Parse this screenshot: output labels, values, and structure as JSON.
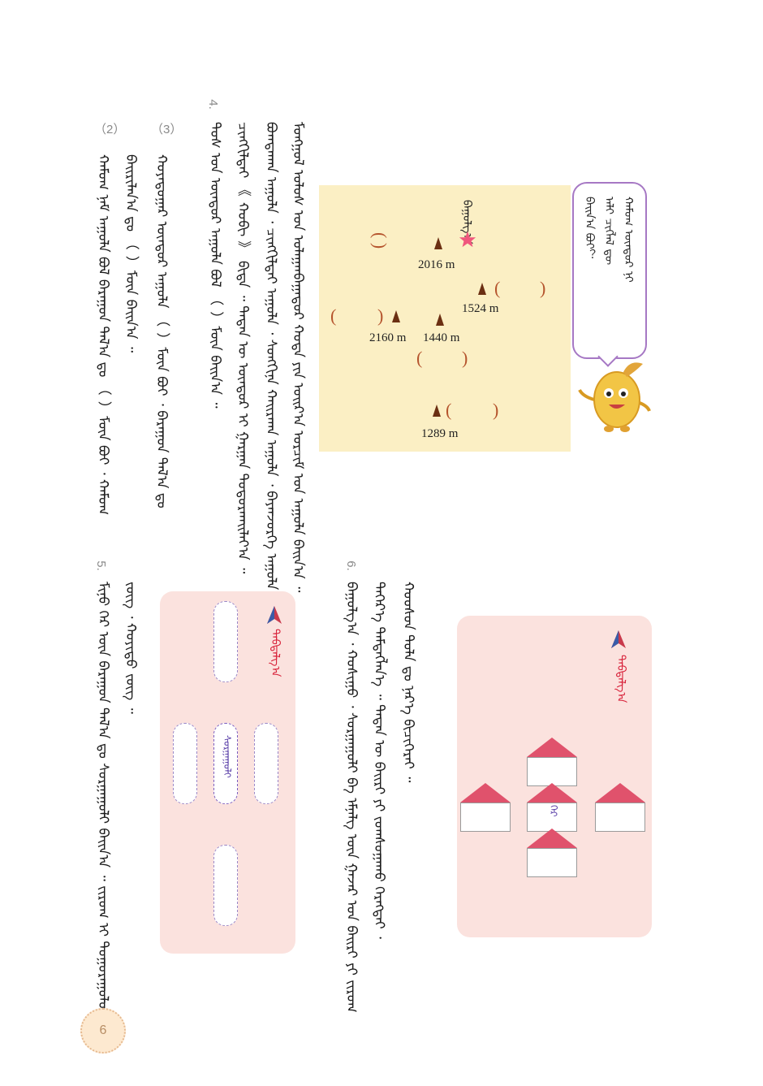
{
  "page_number": "6",
  "q4": {
    "number": "4.",
    "lines": [
      "ᠮᠣᠩᠭᠣᠯ ᠤᠯᠤᠰ ᠤᠨ ᠤᠯᠠᠭᠠᠨᠪᠠᠭᠠᠲᠤᠷ ᠬᠣᠲᠠ ᠶᠢᠨ ᠣᠢᠷ᠎ᠠ ᠣᠷᠴᠢᠮ ᠤᠨ ᠠᠭᠤᠯᠠ ᠪᠠᠢᠨ᠎ᠠ ᠃",
      "ᠪᠣᠭᠳᠠᠬᠠᠨ ᠠᠭᠤᠯᠠ ᠂ ᠴᠢᠩᠭᠢᠯᠲᠡᠢ ᠠᠭᠤᠯᠠ ᠂ ᠰᠣᠩᠭᠢᠨᠠ ᠬᠠᠢᠷᠬᠠᠨ ᠠᠭᠤᠯᠠ ᠂ ᠪᠠᠶᠠᠨᠵᠦᠷᠬᠡ ᠠᠭᠤᠯᠠ ᠂",
      "ᠴᠢᠩᠭᠢᠯᠲᠡᠢ 《 ᠬᠤᠪᠢ 》 ᠪᠢᠳᠡ ᠃ ᠲᠡᠳᠡᠨ ᠦ ᠥᠨᠳᠥᠷ ᠢ ᠭᠠᠷᠭᠠᠨ ᠲᠣᠳᠣᠷᠬᠠᠢᠯᠠᠶ᠎ᠠ ᠃",
      "ᠲᠤᠰ ᠤᠨ ᠥᠨᠳᠥᠷ ᠠᠭᠤᠯᠠ ᠪᠣᠯ （ ）ᠮᠥᠨ ᠪᠠᠢᠨ᠎ᠠ ᠃"
    ],
    "sub3_label": "（3）",
    "sub3_lines": [
      "ᠬᠣᠶᠠᠳᠤᠭᠠᠷ ᠥᠨᠳᠥᠷ ᠠᠭᠤᠯᠠ （ ）ᠮᠥᠨ ᠪᠣᠢ ᠂ ᠪᠠᠷᠠᠭᠤᠨ ᠲᠠᠯ᠎ᠠ ᠳᠤ",
      "ᠪᠠᠢᠷᠢᠯᠠᠨ᠎ᠠ ᠳᠤ （ ）ᠮᠥᠨ ᠪᠠᠢᠨ᠎ᠠ ᠃"
    ],
    "sub2_label": "（2）",
    "sub2_lines": [
      "ᠬᠠᠮᠤᠭ ᠨᠠᠮ ᠠᠭᠤᠯᠠ ᠪᠣᠯ ᠪᠠᠷᠠᠭᠤᠨ ᠲᠠᠯ᠎ᠠ ᠳᠤ （ ）ᠮᠥᠨ ᠪᠣᠢ ᠂ ᠬᠠᠮᠤᠭ"
    ]
  },
  "map": {
    "star_label": "ᠪᠠᠭᠤᠯᠭ᠎ᠠ",
    "elevations": [
      "2016 m",
      "1524 m",
      "2160 m",
      "1440 m",
      "1289 m"
    ],
    "paren": "(          )"
  },
  "bubble_lines": [
    "ᠬᠠᠮᠤᠭ ᠥᠨᠳᠥᠷ ᠨᠢ",
    "ᠠᠯᠢ ᠴᠢᠭᠯᠡᠯ ᠳᠦ",
    "ᠪᠠᠢᠨ᠎ᠠ ᠪᠣᠢ？"
  ],
  "q6": {
    "number": "6.",
    "lines": [
      "ᠪᠠᠭᠤᠯᠭ᠎ᠠ ᠂ ᠬᠣᠰᠢᠭᠤ ᠂ ᠰᠤᠷᠭᠠᠭᠤᠯᠢ ᠪᠠ ᠡᠮᠨᠡᠯᠭ ᠦᠨ ᠭᠠᠵᠠᠷ ᠤᠨ ᠪᠠᠢᠷᠢ ᠶᠢ ᠵᠢᠷᠤᠭ",
      "ᠳᠡᠭᠡᠷ᠎ᠡ ᠲᠡᠮᠳᠡᠭᠯᠡᠨ᠎ᠡ ᠃ ᠲᠡᠳᠡᠨ ᠦ ᠪᠠᠢᠷᠢ ᠶᠢ ᠵᠣᠭᠰᠤᠭᠠᠬᠤ ᠬᠡᠷᠡᠭᠲᠡᠢ ᠂",
      "ᠬᠣᠣᠰᠤᠨ ᠲᠣᠯᠠ ᠳᠤ ᠨᠡᠷ᠎ᠡ ᠪᠢᠴᠢᠭᠡᠷᠡᠢ ᠃"
    ],
    "tag": "ᠳᠠᠪᠳᠠᠯᠭ᠎ᠠ",
    "center_house": "ᠭᠡᠷ"
  },
  "q5": {
    "number": "5.",
    "lines": [
      "ᠮᠢᠨᠤ ᠭᠡᠷ ᠦᠨ ᠪᠠᠷᠠᠭᠤᠨ ᠲᠠᠯ᠎ᠠ ᠳᠤ ᠰᠤᠷᠭᠠᠭᠤᠯᠢ ᠪᠠᠢᠨ᠎ᠠ ᠃ ᠵᠢᠷᠤᠭ ᠢ ᠳᠤᠭᠤᠷᠠᠭᠤᠯᠤᠶ᠎ᠠ",
      "ᠵᠦᠭ ᠂ ᠬᠣᠶᠢᠳᠤ ᠵᠦᠭ ᠃"
    ],
    "tag": "ᠳᠠᠪᠳᠠᠯᠭ᠎ᠠ",
    "center_label": "ᠰᠤᠷᠭᠠᠭᠤᠯᠢ"
  }
}
